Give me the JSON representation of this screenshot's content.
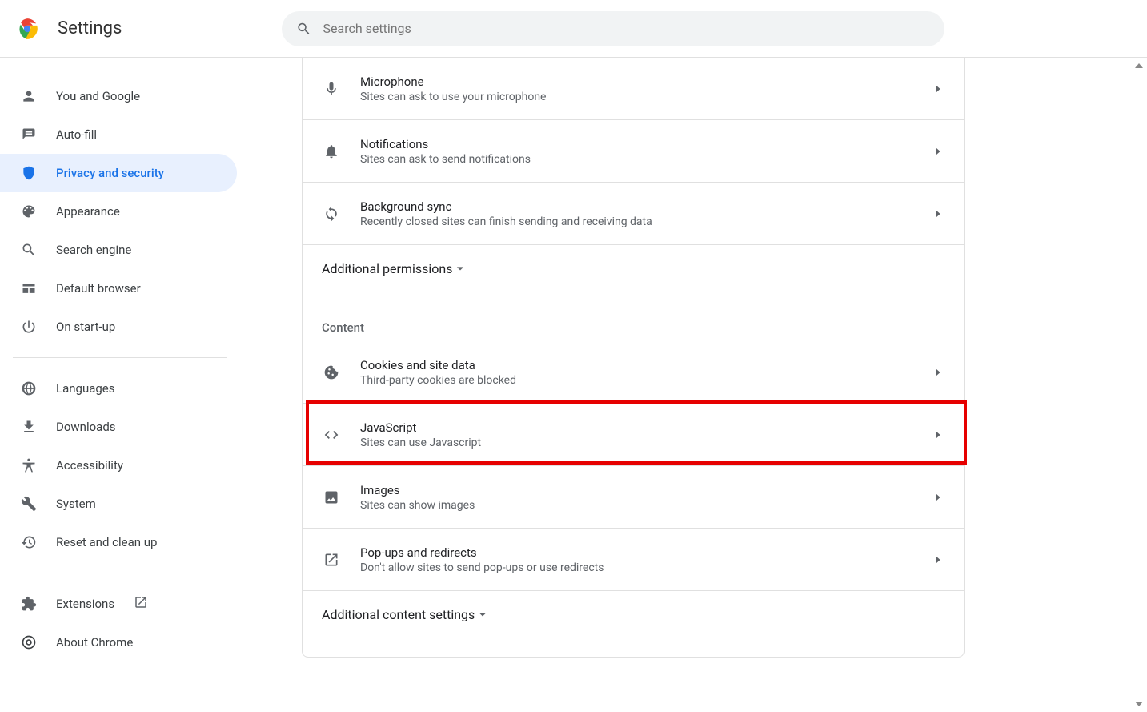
{
  "header": {
    "title": "Settings",
    "search_placeholder": "Search settings"
  },
  "sidebar": {
    "items": [
      {
        "id": "you-and-google",
        "label": "You and Google",
        "icon": "person",
        "active": false
      },
      {
        "id": "autofill",
        "label": "Auto-fill",
        "icon": "autofill",
        "active": false
      },
      {
        "id": "privacy-security",
        "label": "Privacy and security",
        "icon": "shield",
        "active": true
      },
      {
        "id": "appearance",
        "label": "Appearance",
        "icon": "palette",
        "active": false
      },
      {
        "id": "search-engine",
        "label": "Search engine",
        "icon": "search",
        "active": false
      },
      {
        "id": "default-browser",
        "label": "Default browser",
        "icon": "browser",
        "active": false
      },
      {
        "id": "on-startup",
        "label": "On start-up",
        "icon": "power",
        "active": false
      }
    ],
    "advanced": [
      {
        "id": "languages",
        "label": "Languages",
        "icon": "globe"
      },
      {
        "id": "downloads",
        "label": "Downloads",
        "icon": "download"
      },
      {
        "id": "accessibility",
        "label": "Accessibility",
        "icon": "accessibility"
      },
      {
        "id": "system",
        "label": "System",
        "icon": "wrench"
      },
      {
        "id": "reset",
        "label": "Reset and clean up",
        "icon": "restore"
      }
    ],
    "footer": [
      {
        "id": "extensions",
        "label": "Extensions",
        "icon": "extension",
        "external": true
      },
      {
        "id": "about",
        "label": "About Chrome",
        "icon": "chrome"
      }
    ]
  },
  "main": {
    "permissions": [
      {
        "id": "microphone",
        "title": "Microphone",
        "sub": "Sites can ask to use your microphone",
        "icon": "mic"
      },
      {
        "id": "notifications",
        "title": "Notifications",
        "sub": "Sites can ask to send notifications",
        "icon": "bell"
      },
      {
        "id": "background-sync",
        "title": "Background sync",
        "sub": "Recently closed sites can finish sending and receiving data",
        "icon": "sync"
      }
    ],
    "additional_permissions_label": "Additional permissions",
    "content_label": "Content",
    "content": [
      {
        "id": "cookies",
        "title": "Cookies and site data",
        "sub": "Third-party cookies are blocked",
        "icon": "cookie"
      },
      {
        "id": "javascript",
        "title": "JavaScript",
        "sub": "Sites can use Javascript",
        "icon": "code",
        "highlighted": true
      },
      {
        "id": "images",
        "title": "Images",
        "sub": "Sites can show images",
        "icon": "image"
      },
      {
        "id": "popups",
        "title": "Pop-ups and redirects",
        "sub": "Don't allow sites to send pop-ups or use redirects",
        "icon": "popup"
      }
    ],
    "additional_content_label": "Additional content settings"
  }
}
